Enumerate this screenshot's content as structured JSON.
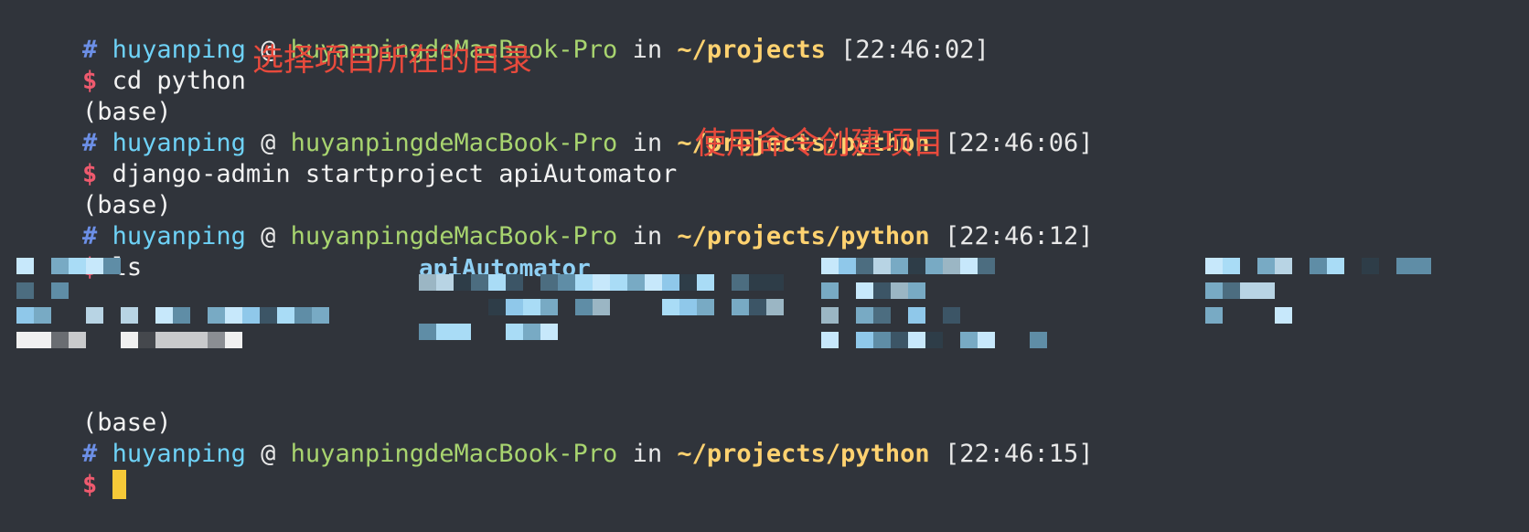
{
  "terminal": {
    "prompts": [
      {
        "hash": "#",
        "user": "huyanping",
        "at": "@",
        "host": "huyanpingdeMacBook-Pro",
        "in": "in",
        "path": "~/projects",
        "time": "[22:46:02]"
      },
      {
        "hash": "#",
        "user": "huyanping",
        "at": "@",
        "host": "huyanpingdeMacBook-Pro",
        "in": "in",
        "path": "~/projects/python",
        "time": "[22:46:06]"
      },
      {
        "hash": "#",
        "user": "huyanping",
        "at": "@",
        "host": "huyanpingdeMacBook-Pro",
        "in": "in",
        "path": "~/projects/python",
        "time": "[22:46:12]"
      },
      {
        "hash": "#",
        "user": "huyanping",
        "at": "@",
        "host": "huyanpingdeMacBook-Pro",
        "in": "in",
        "path": "~/projects/python",
        "time": "[22:46:15]"
      }
    ],
    "commands": [
      {
        "dollar": "$",
        "text": "cd python"
      },
      {
        "dollar": "$",
        "text": "django-admin startproject apiAutomator"
      },
      {
        "dollar": "$",
        "text": "ls"
      },
      {
        "dollar": "$",
        "text": ""
      }
    ],
    "env_labels": [
      "(base)",
      "(base)",
      "(base)"
    ],
    "ls_output": {
      "visible_entry": "apiAutomator"
    },
    "annotations": [
      "选择项目所在的目录",
      "使用命令创建项目"
    ]
  },
  "colors": {
    "background": "#30343b",
    "hash": "#6c8fe6",
    "user": "#6ed2f7",
    "host": "#a8d46f",
    "path": "#ffd270",
    "dollar": "#ef5a6e",
    "annotation": "#e84a3c",
    "cursor": "#f6c938",
    "directory": "#8fd0f4"
  }
}
